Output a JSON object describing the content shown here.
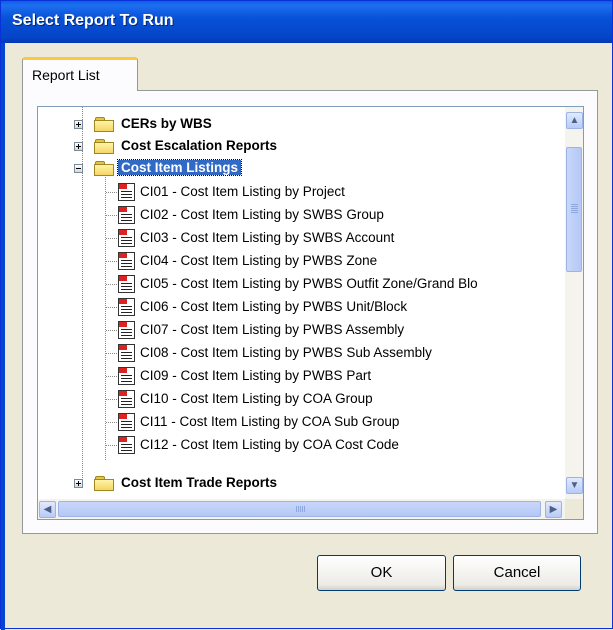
{
  "window": {
    "title": "Select Report To Run"
  },
  "tabs": [
    {
      "label": "Report List"
    }
  ],
  "tree": {
    "items": [
      {
        "type": "folder",
        "label": "CERs by WBS",
        "expanded": false,
        "selected": false
      },
      {
        "type": "folder",
        "label": "Cost Escalation Reports",
        "expanded": false,
        "selected": false
      },
      {
        "type": "folder",
        "label": "Cost Item Listings",
        "expanded": true,
        "selected": true
      },
      {
        "type": "report",
        "label": "CI01 - Cost Item Listing by Project"
      },
      {
        "type": "report",
        "label": "CI02 - Cost Item Listing by SWBS Group"
      },
      {
        "type": "report",
        "label": "CI03 - Cost Item Listing by SWBS Account"
      },
      {
        "type": "report",
        "label": "CI04 - Cost Item Listing by PWBS Zone"
      },
      {
        "type": "report",
        "label": "CI05 - Cost Item Listing by PWBS Outfit Zone/Grand Blo"
      },
      {
        "type": "report",
        "label": "CI06 - Cost Item Listing by PWBS Unit/Block"
      },
      {
        "type": "report",
        "label": "CI07 - Cost  Item Listing by PWBS Assembly"
      },
      {
        "type": "report",
        "label": "CI08 - Cost Item Listing by PWBS Sub Assembly"
      },
      {
        "type": "report",
        "label": "CI09 - Cost Item Listing by PWBS Part"
      },
      {
        "type": "report",
        "label": "CI10 - Cost Item Listing by COA Group"
      },
      {
        "type": "report",
        "label": "CI11 - Cost Item Listing by COA Sub Group"
      },
      {
        "type": "report",
        "label": "CI12 - Cost Item Listing by COA Cost Code"
      },
      {
        "type": "folder",
        "label": "Cost Item Trade Reports",
        "expanded": false,
        "selected": false
      }
    ]
  },
  "scrollbars": {
    "vertical": {
      "up_icon": "chevron-up-icon",
      "down_icon": "chevron-down-icon"
    },
    "horizontal": {
      "left_icon": "chevron-left-icon",
      "right_icon": "chevron-right-icon"
    }
  },
  "buttons": {
    "ok_label": "OK",
    "cancel_label": "Cancel"
  },
  "colors": {
    "titlebar": "#0752D8",
    "selection": "#316AC5",
    "dialog_bg": "#ECE9D8",
    "tab_accent": "#FFC83C"
  }
}
